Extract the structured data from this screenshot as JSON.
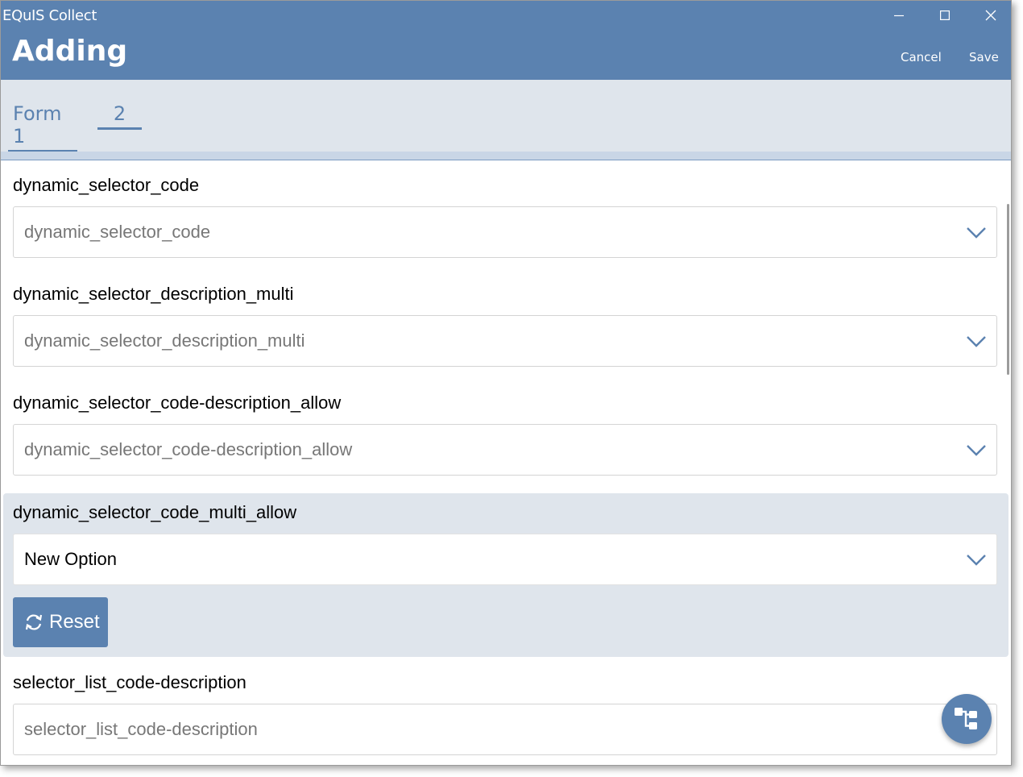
{
  "window": {
    "app_title": "EQuIS Collect",
    "page_title": "Adding",
    "cancel_label": "Cancel",
    "save_label": "Save"
  },
  "tabs": [
    {
      "label": "Form 1",
      "selected": true
    },
    {
      "label": "2",
      "selected": false
    }
  ],
  "fields": [
    {
      "label": "dynamic_selector_code",
      "placeholder": "dynamic_selector_code",
      "value": ""
    },
    {
      "label": "dynamic_selector_description_multi",
      "placeholder": "dynamic_selector_description_multi",
      "value": ""
    },
    {
      "label": "dynamic_selector_code-description_allow",
      "placeholder": "dynamic_selector_code-description_allow",
      "value": ""
    },
    {
      "label": "dynamic_selector_code_multi_allow",
      "placeholder": "",
      "value": "New Option",
      "highlighted": true
    },
    {
      "label": "selector_list_code-description",
      "placeholder": "selector_list_code-description",
      "value": ""
    }
  ],
  "reset_label": "Reset",
  "colors": {
    "accent": "#5b82b0",
    "tab_bar_bg": "#dfe5ec",
    "placeholder_text": "#777777"
  },
  "icons": {
    "minimize": "minimize-icon",
    "maximize": "maximize-icon",
    "close": "close-icon",
    "dropdown": "chevron-down-icon",
    "reset": "refresh-icon",
    "fab": "hierarchy-icon"
  }
}
